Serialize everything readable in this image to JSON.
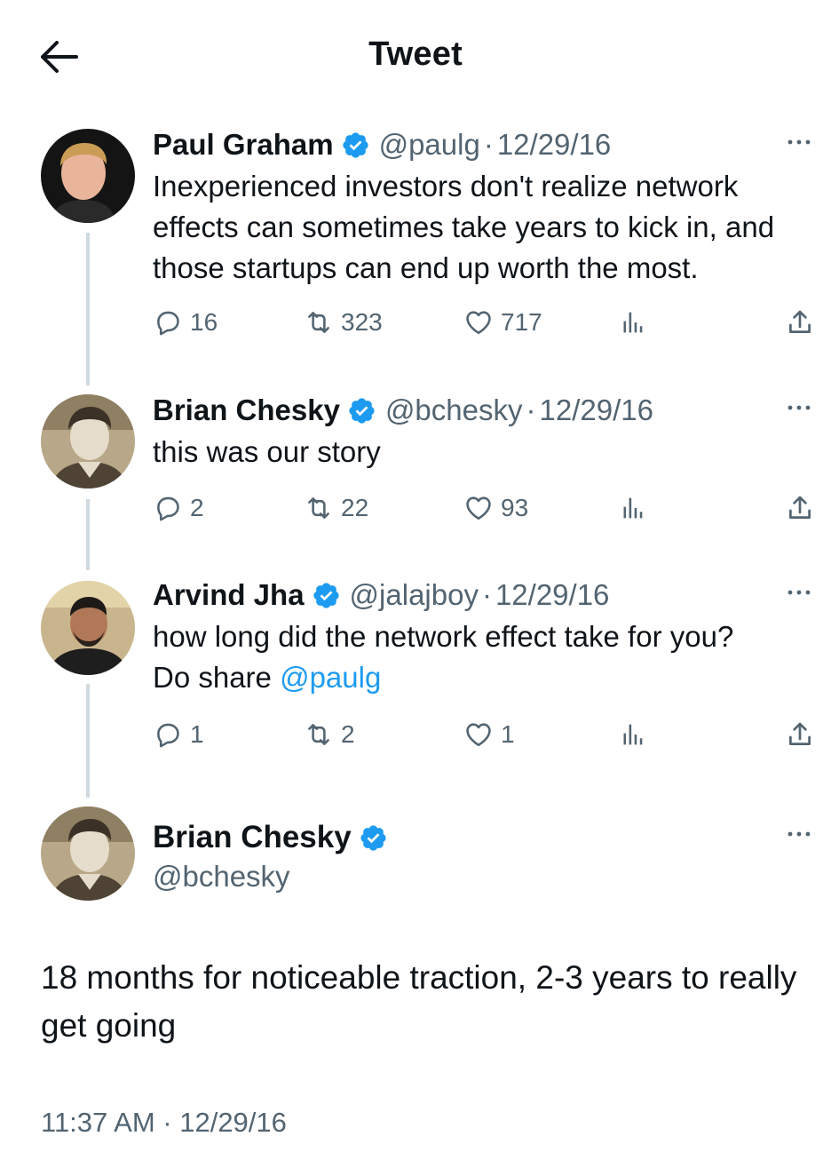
{
  "header": {
    "title": "Tweet"
  },
  "colors": {
    "accent": "#1d9bf0",
    "muted": "#536471",
    "text": "#0f1419",
    "line": "#cfd9de"
  },
  "icons": {
    "back": "arrow-left-icon",
    "verified": "verified-badge-icon",
    "more": "more-dots-icon",
    "reply": "reply-icon",
    "retweet": "retweet-icon",
    "like": "heart-icon",
    "views": "views-icon",
    "share": "share-icon"
  },
  "thread": [
    {
      "name": "Paul Graham",
      "handle": "@paulg",
      "separator": "·",
      "date": "12/29/16",
      "text": "Inexperienced investors don't realize network effects can sometimes take years to kick in, and those startups can end up worth the most.",
      "replies": "16",
      "retweets": "323",
      "likes": "717"
    },
    {
      "name": "Brian Chesky",
      "handle": "@bchesky",
      "separator": "·",
      "date": "12/29/16",
      "text": "this was our story",
      "replies": "2",
      "retweets": "22",
      "likes": "93"
    },
    {
      "name": "Arvind Jha",
      "handle": "@jalajboy",
      "separator": "·",
      "date": "12/29/16",
      "text_line1": "how long did the network effect take for you?",
      "text_line2_prefix": "Do share ",
      "text_mention": "@paulg",
      "replies": "1",
      "retweets": "2",
      "likes": "1"
    }
  ],
  "main_tweet": {
    "name": "Brian Chesky",
    "handle": "@bchesky",
    "text": "18 months for noticeable traction, 2-3 years to really get going",
    "timestamp": "11:37 AM · 12/29/16"
  }
}
